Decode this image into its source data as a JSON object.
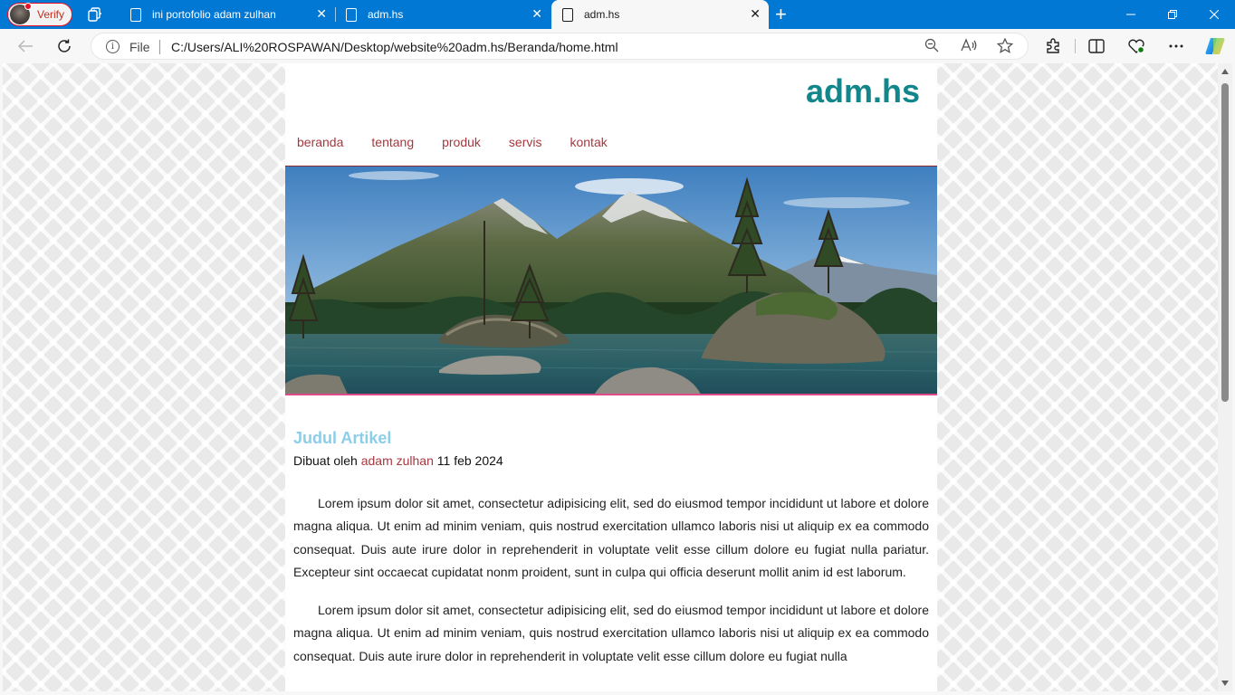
{
  "browser": {
    "profile_label": "Verify",
    "tabs": [
      {
        "title": "ini portofolio adam zulhan"
      },
      {
        "title": "adm.hs"
      },
      {
        "title": "adm.hs"
      }
    ],
    "address": {
      "scheme_label": "File",
      "url": "C:/Users/ALI%20ROSPAWAN/Desktop/website%20adm.hs/Beranda/home.html"
    },
    "accent_color": "#0078d4"
  },
  "site": {
    "title": "adm.hs",
    "title_color": "#12868a",
    "nav": [
      "beranda",
      "tentang",
      "produk",
      "servis",
      "kontak"
    ],
    "nav_color": "#a8373f",
    "hero_alt": "landscape-photo"
  },
  "article": {
    "title": "Judul Artikel",
    "byline_prefix": "Dibuat oleh",
    "author": "adam zulhan",
    "date": "11 feb 2024",
    "paragraphs": [
      "Lorem ipsum dolor sit amet, consectetur adipisicing elit, sed do eiusmod tempor incididunt ut labore et dolore magna aliqua. Ut enim ad minim veniam, quis nostrud exercitation ullamco laboris nisi ut aliquip ex ea commodo consequat. Duis aute irure dolor in reprehenderit in voluptate velit esse cillum dolore eu fugiat nulla pariatur. Excepteur sint occaecat cupidatat nonm proident, sunt in culpa qui officia deserunt mollit anim id est laborum.",
      "Lorem ipsum dolor sit amet, consectetur adipisicing elit, sed do eiusmod tempor incididunt ut labore et dolore magna aliqua. Ut enim ad minim veniam, quis nostrud exercitation ullamco laboris nisi ut aliquip ex ea commodo consequat. Duis aute irure dolor in reprehenderit in voluptate velit esse cillum dolore eu fugiat nulla"
    ]
  }
}
